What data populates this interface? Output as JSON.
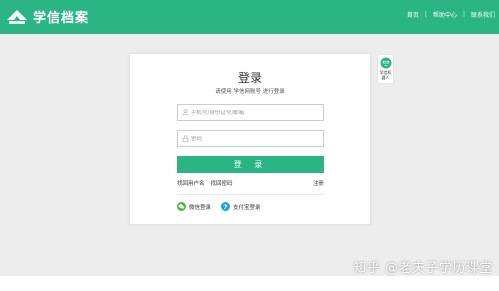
{
  "header": {
    "brand": "学信档案",
    "nav": [
      "首页",
      "帮助中心",
      "联系我们"
    ],
    "nav_separator": "|",
    "background": "#2bb585"
  },
  "login": {
    "title": "登录",
    "subtitle": "请使用 学信网账号 进行登录",
    "username_placeholder": "手机号/身份证号/邮箱",
    "username_icon": "user-icon",
    "password_placeholder": "密码",
    "password_icon": "lock-icon",
    "submit_label": "登 录",
    "find_username": "找回用户名",
    "find_password": "找回密码",
    "register": "注册",
    "third_party": [
      {
        "label": "微信登录",
        "icon": "wechat-icon",
        "color": "#4bb93a"
      },
      {
        "label": "支付宝登录",
        "icon": "alipay-icon",
        "color": "#1e9fe8"
      }
    ],
    "accent": "#2bb585"
  },
  "robot": {
    "label": "学信机器人",
    "icon": "robot-icon"
  },
  "watermark": "知乎 @老夫子学历课堂"
}
